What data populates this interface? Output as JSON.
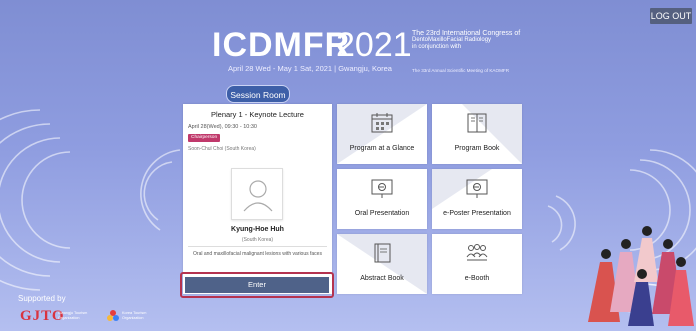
{
  "top_bar": {
    "logout_label": "LOG OUT"
  },
  "event": {
    "name": "ICDMFR",
    "year": "2021",
    "info_line1": "The 23rd International Congress of",
    "info_line2": "DentoMaxilloFacial Radiology",
    "info_line3": "in conjunction with",
    "dates": "April 28 Wed - May 1 Sat, 2021 | Gwangju, Korea",
    "sub": "The 33rd Annual Scientific Meeting of KAOMFR"
  },
  "session_room": {
    "title": "Session Room"
  },
  "session_card": {
    "title": "Plenary 1 - Keynote Lecture",
    "time": "April 28(Wed), 09:30 - 10:30",
    "chair_badge": "Chairperson",
    "chair_name": "Soon-Chul Choi (South Korea)",
    "speaker_name": "Kyung-Hoe Huh",
    "speaker_country": "(South Korea)",
    "topic": "Oral and maxillofacial malignant lesions with various faces",
    "enter_label": "Enter"
  },
  "tiles": [
    {
      "label": "Program at a Glance",
      "icon": "calendar-icon"
    },
    {
      "label": "Program Book",
      "icon": "open-book-icon"
    },
    {
      "label": "Oral Presentation",
      "icon": "presentation-screen-icon"
    },
    {
      "label": "e-Poster Presentation",
      "icon": "poster-screen-icon"
    },
    {
      "label": "Abstract Book",
      "icon": "closed-book-icon"
    },
    {
      "label": "e-Booth",
      "icon": "people-icon"
    }
  ],
  "footer": {
    "supported_by": "Supported by",
    "sponsor1_logo": "GJTO",
    "sponsor1_sub": "Gwangju Tourism Organization",
    "sponsor2_sub": "Korea Tourism Organization"
  },
  "colors": {
    "background": "#8f9de0",
    "session_room_bg": "#3d5fa8",
    "enter_bg": "#4f6289",
    "enter_border": "#b5334f",
    "chair_badge_bg": "#c0396b",
    "logout_bg": "#55607f"
  }
}
